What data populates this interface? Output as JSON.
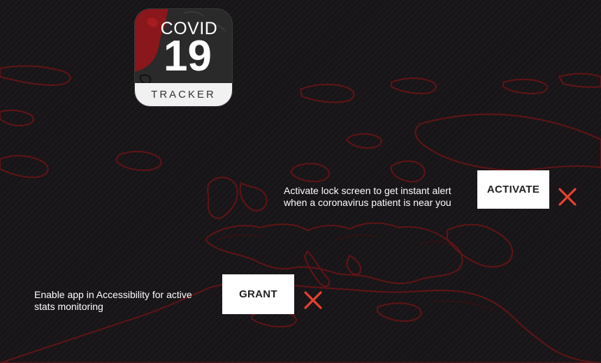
{
  "app_icon": {
    "line1": "COVID",
    "line2": "19",
    "line3": "TRACKER"
  },
  "lockscreen_prompt": {
    "line1": "Activate lock screen to get instant alert",
    "line2": "when a coronavirus patient is near you",
    "button_label": "ACTIVATE",
    "close_icon": "close-icon"
  },
  "accessibility_prompt": {
    "line1": "Enable app in Accessibility for active",
    "line2": "stats monitoring",
    "button_label": "GRANT",
    "close_icon": "close-icon"
  },
  "colors": {
    "background": "#171517",
    "map_outline": "#6e1518",
    "close_red": "#e8412f",
    "button_bg": "#ffffff"
  }
}
